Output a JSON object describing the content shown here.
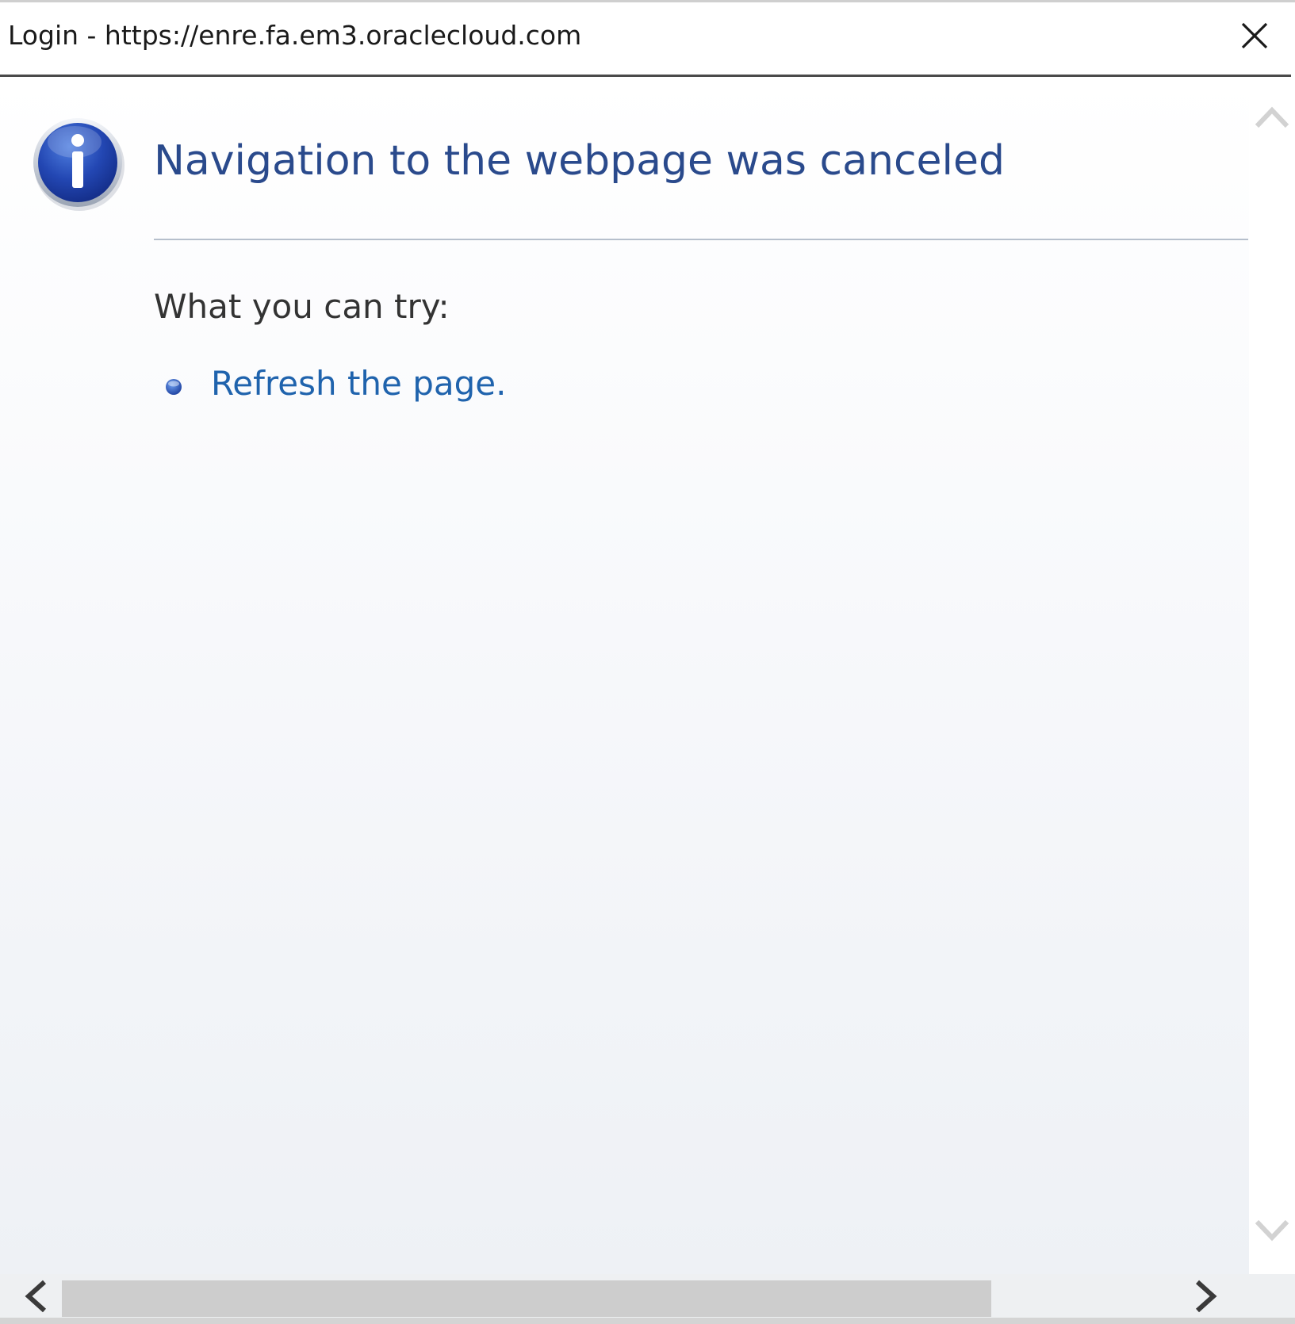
{
  "window": {
    "title": "Login - https://enre.fa.em3.oraclecloud.com"
  },
  "icons": {
    "close": "close-icon",
    "info": "info-icon",
    "scroll_up": "chevron-up-icon",
    "scroll_down": "chevron-down-icon",
    "scroll_left": "chevron-left-icon",
    "scroll_right": "chevron-right-icon"
  },
  "page": {
    "heading": "Navigation to the webpage was canceled",
    "try_label": "What you can try:",
    "suggestions": [
      {
        "label": "Refresh the page."
      }
    ]
  },
  "colors": {
    "heading": "#2a4a8c",
    "link": "#1f63ad",
    "info_icon": "#1e46b4"
  }
}
